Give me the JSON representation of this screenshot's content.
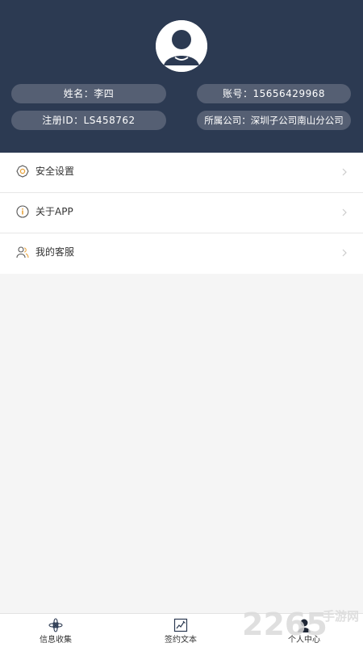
{
  "profile": {
    "name_text": "姓名：李四",
    "account_text": "账号：15656429968",
    "register_text": "注册ID：LS458762",
    "company_text": "所属公司：深圳子公司南山分公司"
  },
  "menu": {
    "items": [
      {
        "label": "安全设置",
        "icon": "gear-icon"
      },
      {
        "label": "关于APP",
        "icon": "info-icon"
      },
      {
        "label": "我的客服",
        "icon": "service-icon"
      }
    ]
  },
  "tabbar": {
    "tabs": [
      {
        "label": "信息收集",
        "icon": "flower-icon"
      },
      {
        "label": "签约文本",
        "icon": "sign-document-icon"
      },
      {
        "label": "个人中心",
        "icon": "person-icon",
        "active": true
      }
    ]
  },
  "watermark": {
    "brand": "2265",
    "tagline": "手游网"
  },
  "colors": {
    "header_bg": "#2c3a52",
    "pill_bg": "#555f73",
    "icon_accent": "#e8a23a"
  }
}
